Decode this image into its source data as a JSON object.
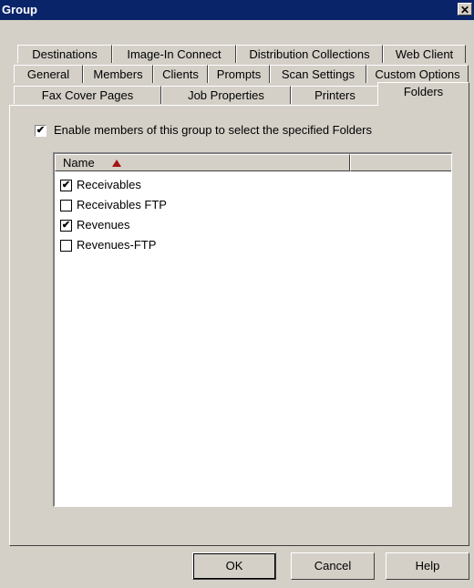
{
  "window": {
    "title": "Group",
    "close_glyph": "✕"
  },
  "tabs": {
    "row1": [
      "Destinations",
      "Image-In Connect",
      "Distribution Collections",
      "Web Client"
    ],
    "row2": [
      "General",
      "Members",
      "Clients",
      "Prompts",
      "Scan Settings",
      "Custom Options"
    ],
    "row3": [
      "Fax Cover Pages",
      "Job Properties",
      "Printers",
      "Folders"
    ],
    "active": "Folders"
  },
  "folders_tab": {
    "enable_label": "Enable members of this group to select the specified Folders",
    "enable_checked": true,
    "column_header": "Name",
    "sort_icon": "sort-ascending-icon",
    "items": [
      {
        "label": "Receivables",
        "checked": true
      },
      {
        "label": "Receivables FTP",
        "checked": false
      },
      {
        "label": "Revenues",
        "checked": true
      },
      {
        "label": "Revenues-FTP",
        "checked": false
      }
    ]
  },
  "buttons": {
    "ok": "OK",
    "cancel": "Cancel",
    "help": "Help"
  },
  "colors": {
    "titlebar": "#0a246a",
    "face": "#d4d0c8",
    "sort_arrow": "#a31515"
  }
}
